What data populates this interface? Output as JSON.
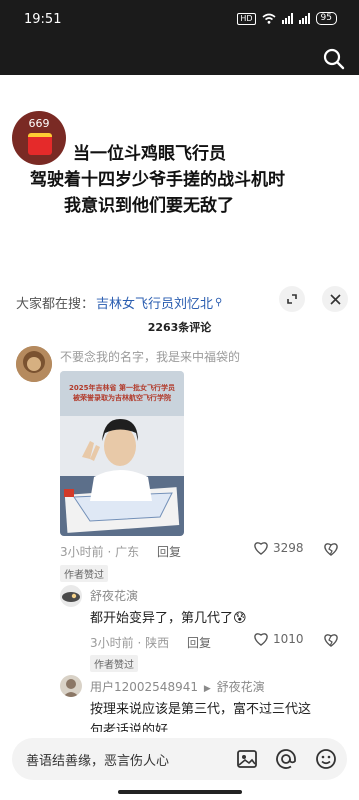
{
  "status_bar": {
    "time": "19:51",
    "battery": "95",
    "hd_label": "HD"
  },
  "video": {
    "badge_number": "669",
    "caption_lines": [
      "当一位斗鸡眼飞行员",
      "驾驶着十四岁少爷手搓的战斗机时",
      "我意识到他们要无敌了"
    ]
  },
  "search_bar": {
    "label": "大家都在搜：",
    "query": "吉林女飞行员刘忆北",
    "query_icon": "search-small-icon"
  },
  "comments_header": {
    "count": "2263条评论"
  },
  "comment1": {
    "text": "不要念我的名字，我是来中福袋的",
    "time": "3小时前",
    "location": "广东",
    "reply_label": "回复",
    "likes": "3298",
    "tag": "作者赞过",
    "photo_banner": "2025年吉林省 第一批女飞行学员 被荣誉录取为吉林航空飞行学院"
  },
  "reply1": {
    "author": "舒夜花演",
    "text": "都开始变异了，第几代了",
    "emoji": "😰",
    "time": "3小时前",
    "location": "陕西",
    "reply_label": "回复",
    "likes": "1010",
    "tag": "作者赞过"
  },
  "reply2": {
    "author": "用户12002548941",
    "reply_to": "舒夜花演",
    "text_line1": "按理来说应该是第三代，富不过三代这",
    "text_line2": "句老话说的好"
  },
  "input_bar": {
    "placeholder": "善语结善缘，恶言伤人心"
  },
  "colors": {
    "accent_link": "#2a5db0",
    "status_bg": "#1b1b1b"
  }
}
